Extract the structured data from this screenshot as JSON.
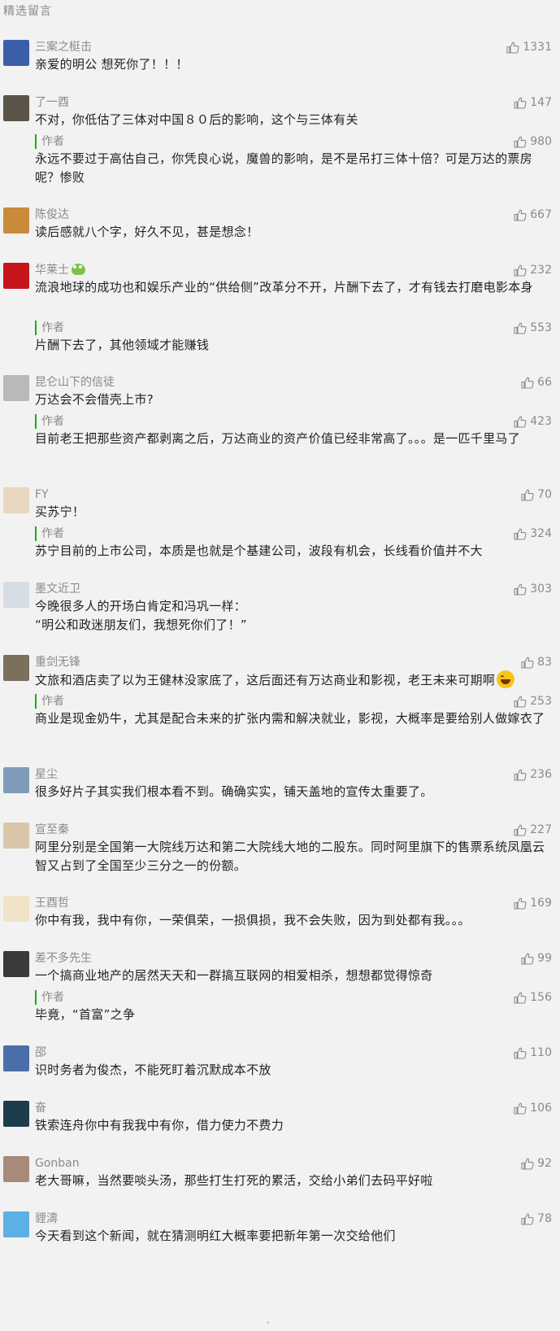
{
  "section": {
    "title": "精选留言"
  },
  "author_label": "作者",
  "comments": [
    {
      "name": "三案之梃击",
      "likes": "1331",
      "text": "亲爱的明公 想死你了！！！",
      "reply": null,
      "avatar_color": "#3a5ea8"
    },
    {
      "name": "了一酉",
      "likes": "147",
      "text": "不对，你低估了三体对中国８０后的影响，这个与三体有关",
      "reply": {
        "likes": "980",
        "text": "永远不要过于高估自己，你凭良心说，魔兽的影响，是不是吊打三体十倍？可是万达的票房呢？惨败"
      },
      "avatar_color": "#5a5548"
    },
    {
      "name": "陈俊达",
      "likes": "667",
      "text": "读后感就八个字，好久不见，甚是想念！",
      "reply": null,
      "avatar_color": "#c98a3a"
    },
    {
      "name": "华莱士",
      "likes": "232",
      "text": "流浪地球的成功也和娱乐产业的“供给侧”改革分不开，片酬下去了，才有钱去打磨电影本身",
      "reply": {
        "likes": "553",
        "text": "片酬下去了，其他领域才能赚钱"
      },
      "avatar_color": "#c4161c"
    },
    {
      "name": "昆仑山下的信徒",
      "likes": "66",
      "text": "万达会不会借壳上市?",
      "reply": {
        "likes": "423",
        "text": "目前老王把那些资产都剥离之后，万达商业的资产价值已经非常高了。。。是一匹千里马了"
      },
      "avatar_color": "#b9b9b9"
    },
    {
      "name": "FY",
      "likes": "70",
      "text": "买苏宁！",
      "reply": {
        "likes": "324",
        "text": "苏宁目前的上市公司，本质是也就是个基建公司，波段有机会，长线看价值并不大"
      },
      "avatar_color": "#e8d8c0"
    },
    {
      "name": "墨文近卫",
      "likes": "303",
      "text": "今晚很多人的开场白肯定和冯巩一样：\n“明公和政迷朋友们，我想死你们了！”",
      "reply": null,
      "avatar_color": "#d7dde4"
    },
    {
      "name": "重剑无锋",
      "likes": "83",
      "text": "文旅和酒店卖了以为王健林没家底了，这后面还有万达商业和影视，老王未来可期啊",
      "reply": {
        "likes": "253",
        "text": "商业是现金奶牛，尤其是配合未来的扩张内需和解决就业，影视，大概率是要给别人做嫁衣了"
      },
      "avatar_color": "#7b6f5e"
    },
    {
      "name": "星尘",
      "likes": "236",
      "text": "很多好片子其实我们根本看不到。确确实实，铺天盖地的宣传太重要了。",
      "reply": null,
      "avatar_color": "#7f9bb8"
    },
    {
      "name": "宣至秦",
      "likes": "227",
      "text": "阿里分别是全国第一大院线万达和第二大院线大地的二股东。同时阿里旗下的售票系统凤凰云智又占到了全国至少三分之一的份额。",
      "reply": null,
      "avatar_color": "#d9c6a8"
    },
    {
      "name": "王酉哲",
      "likes": "169",
      "text": "你中有我，我中有你，一荣俱荣，一损俱损，我不会失败，因为到处都有我。。。",
      "reply": null,
      "avatar_color": "#f0e3c8"
    },
    {
      "name": "差不多先生",
      "likes": "99",
      "text": "一个搞商业地产的居然天天和一群搞互联网的相爱相杀，想想都觉得惊奇",
      "reply": {
        "likes": "156",
        "text": "毕竟，“首富”之争"
      },
      "avatar_color": "#3a3a3a"
    },
    {
      "name": "邵",
      "likes": "110",
      "text": "识时务者为俊杰，不能死盯着沉默成本不放",
      "reply": null,
      "avatar_color": "#4a6fa8"
    },
    {
      "name": "奋",
      "likes": "106",
      "text": "铁索连舟你中有我我中有你，借力使力不费力",
      "reply": null,
      "avatar_color": "#1b3c4a"
    },
    {
      "name": "Gonban",
      "likes": "92",
      "text": "老大哥嘛，当然要啖头汤，那些打生打死的累活，交给小弟们去码平好啦",
      "reply": null,
      "avatar_color": "#a98a7a"
    },
    {
      "name": "貍濤",
      "likes": "78",
      "text": "今天看到这个新闻，就在猜测明红大概率要把新年第一次交给他们",
      "reply": null,
      "avatar_color": "#5db0e6"
    }
  ]
}
